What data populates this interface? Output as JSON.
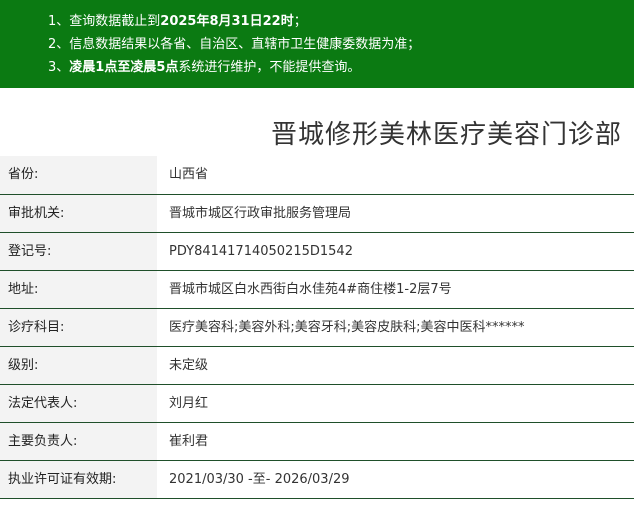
{
  "notice": {
    "line1_prefix": "1、查询数据截止到",
    "line1_bold": "2025年8月31日22时",
    "line1_suffix": "；",
    "line2": "2、信息数据结果以各省、自治区、直辖市卫生健康委数据为准；",
    "line3_prefix": "3、",
    "line3_bold": "凌晨1点至凌晨5点",
    "line3_suffix": "系统进行维护，不能提供查询。"
  },
  "title": "晋城修形美林医疗美容门诊部",
  "rows": [
    {
      "label": "省份:",
      "value": "山西省"
    },
    {
      "label": "审批机关:",
      "value": "晋城市城区行政审批服务管理局"
    },
    {
      "label": "登记号:",
      "value": "PDY84141714050215D1542"
    },
    {
      "label": "地址:",
      "value": "晋城市城区白水西街白水佳苑4#商住楼1-2层7号"
    },
    {
      "label": "诊疗科目:",
      "value": "医疗美容科;美容外科;美容牙科;美容皮肤科;美容中医科******"
    },
    {
      "label": "级别:",
      "value": "未定级"
    },
    {
      "label": "法定代表人:",
      "value": "刘月红"
    },
    {
      "label": "主要负责人:",
      "value": "崔利君"
    },
    {
      "label": "执业许可证有效期:",
      "value": "2021/03/30 -至- 2026/03/29"
    }
  ]
}
